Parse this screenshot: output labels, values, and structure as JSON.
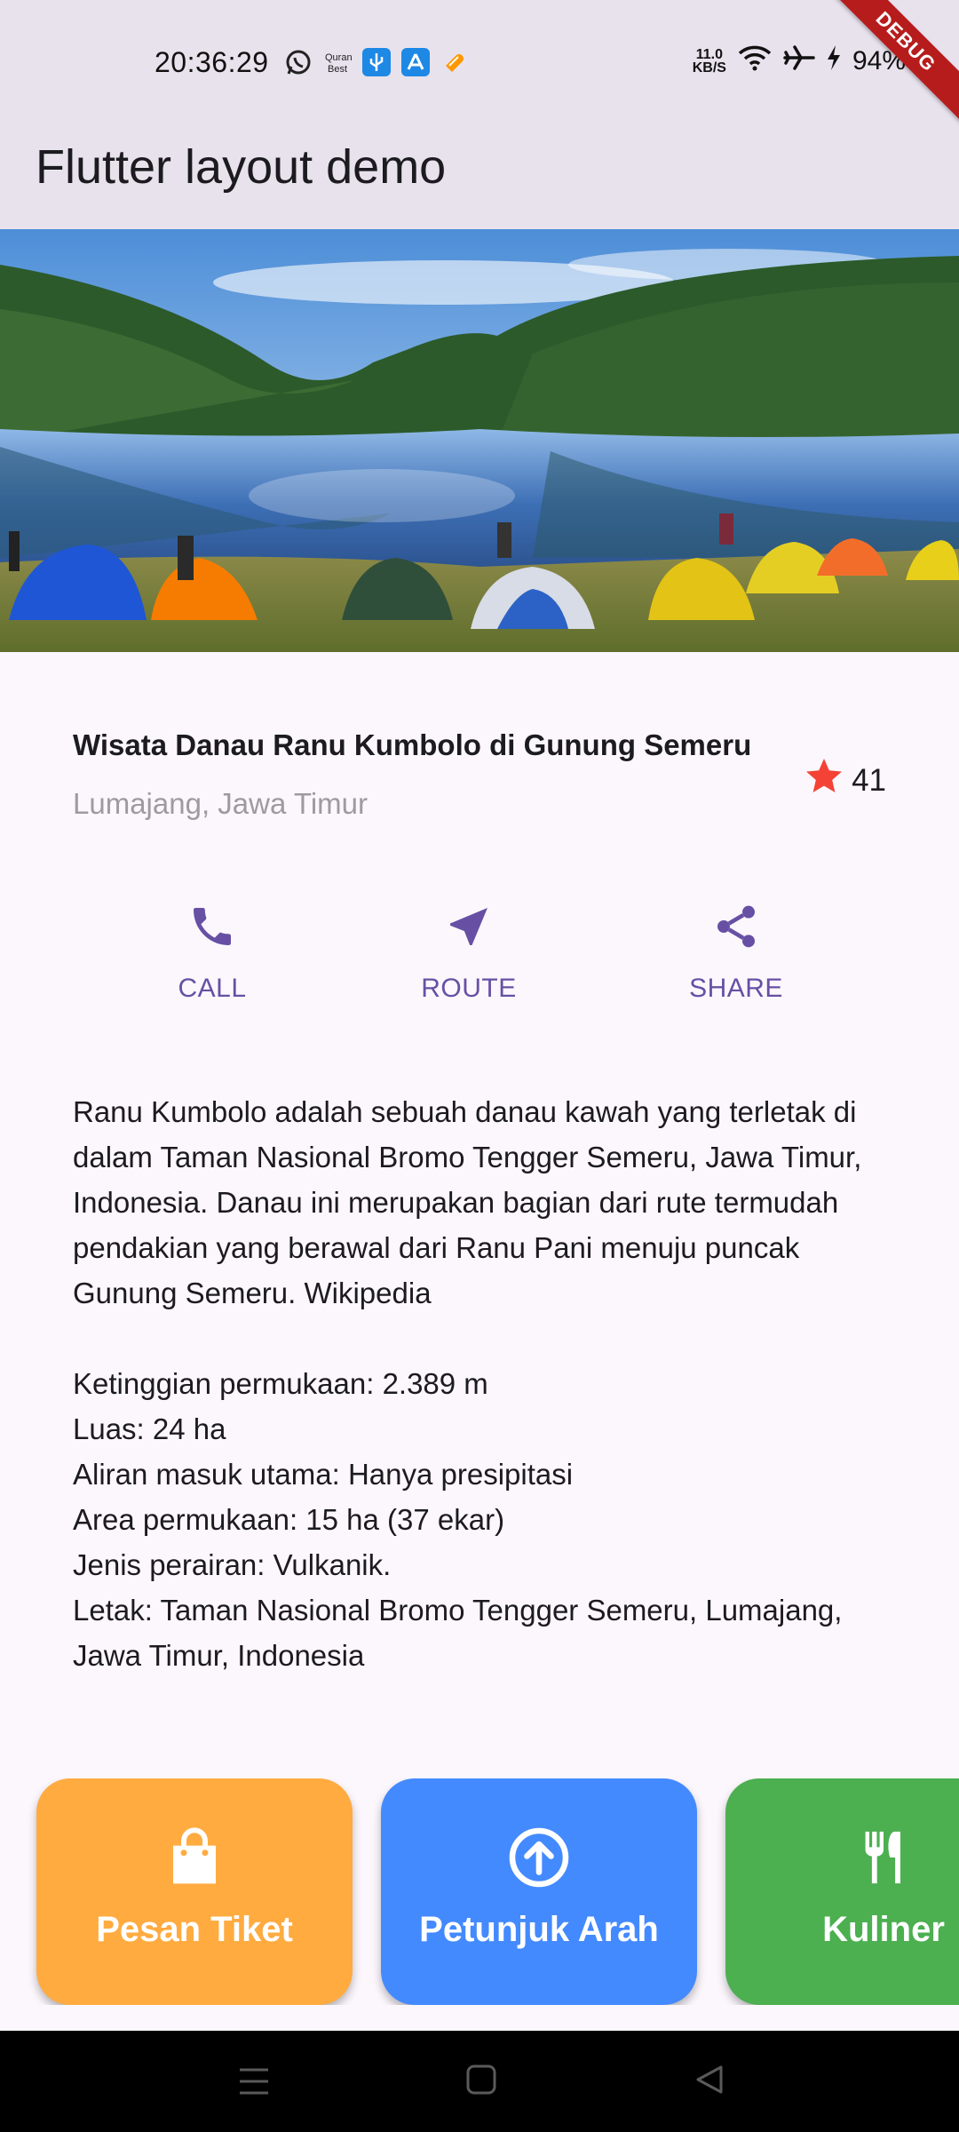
{
  "status_bar": {
    "time": "20:36:29",
    "net_speed_value": "11.0",
    "net_speed_unit": "KB/S",
    "battery": "94%",
    "notification_icons": [
      "whatsapp-icon",
      "quran-best-icon",
      "usb-icon",
      "app-store-icon",
      "heart-app-icon"
    ],
    "debug_label": "DEBUG"
  },
  "app_bar": {
    "title": "Flutter layout demo"
  },
  "hero_image": {
    "subject": "lake with tents"
  },
  "place": {
    "title": "Wisata Danau Ranu Kumbolo di Gunung Semeru",
    "subtitle": "Lumajang, Jawa Timur",
    "rating": "41"
  },
  "actions": [
    {
      "label": "CALL",
      "icon": "phone-icon"
    },
    {
      "label": "ROUTE",
      "icon": "navigation-arrow-icon"
    },
    {
      "label": "SHARE",
      "icon": "share-icon"
    }
  ],
  "description": {
    "paragraph": "Ranu Kumbolo adalah sebuah danau kawah yang terletak di dalam Taman Nasional Bromo Tengger Semeru, Jawa Timur, Indonesia. Danau ini merupakan bagian dari rute termudah pendakian yang berawal dari Ranu Pani menuju puncak Gunung Semeru. Wikipedia",
    "facts": [
      "Ketinggian permukaan: 2.389 m",
      "Luas: 24 ha",
      "Aliran masuk utama: Hanya presipitasi",
      "Area permukaan: 15 ha (37 ekar)",
      "Jenis perairan: Vulkanik.",
      "Letak: Taman Nasional Bromo Tengger Semeru, Lumajang, Jawa Timur, Indonesia"
    ]
  },
  "bottom_buttons": [
    {
      "label": "Pesan Tiket",
      "icon": "shopping-bag-icon",
      "color": "#FFAB40"
    },
    {
      "label": "Petunjuk Arah",
      "icon": "arrow-circle-up-icon",
      "color": "#448AFF"
    },
    {
      "label": "Kuliner",
      "icon": "restaurant-icon",
      "color": "#4CAF50"
    }
  ],
  "colors": {
    "primary": "#6750A4",
    "star": "#F44336"
  }
}
